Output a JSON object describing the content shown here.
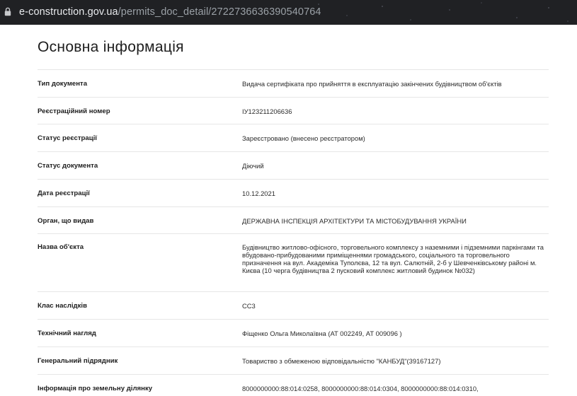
{
  "browser": {
    "url_host": "e-construction.gov.ua",
    "url_path": "/permits_doc_detail/2722736636390540764"
  },
  "section": {
    "title": "Основна інформація"
  },
  "rows": [
    {
      "label": "Тип документа",
      "value": "Видача сертифіката про прийняття в експлуатацію закінчених будівництвом об'єктів"
    },
    {
      "label": "Реєстраційний номер",
      "value": "ІУ123211206636"
    },
    {
      "label": "Статус реєстрації",
      "value": "Зареєстровано (внесено реєстратором)"
    },
    {
      "label": "Статус документа",
      "value": "Діючий"
    },
    {
      "label": "Дата реєстрації",
      "value": "10.12.2021"
    },
    {
      "label": "Орган, що видав",
      "value": "ДЕРЖАВНА ІНСПЕКЦІЯ АРХІТЕКТУРИ ТА МІСТОБУДУВАННЯ УКРАЇНИ"
    },
    {
      "label": "Назва об'єкта",
      "value": "Будівництво житлово-офісного, торговельного комплексу з наземними і підземними паркінгами та вбудовано-прибудованими приміщеннями громадського, соціального та торговельного призначення на вул. Академіка Туполєва, 12 та вул. Салютній, 2-б у Шевченківському районі м. Києва (10 черга будівництва 2 пусковий комплекс житловий будинок №032)"
    },
    {
      "label": "Клас наслідків",
      "value": "СС3"
    },
    {
      "label": "Технічний нагляд",
      "value": "Фіщенко Ольга Миколаївна (АТ 002249, АТ 009096 )"
    },
    {
      "label": "Генеральний підрядник",
      "value": "Товариство з обмеженою відповідальністю \"КАНБУД\"(39167127)"
    },
    {
      "label": "Інформація про земельну ділянку",
      "value": "8000000000:88:014:0258, 8000000000:88:014:0304, 8000000000:88:014:0310,"
    }
  ]
}
